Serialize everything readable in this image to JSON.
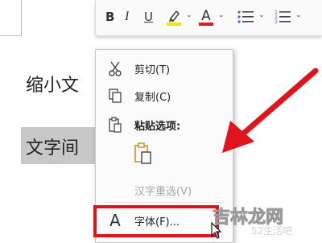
{
  "toolbar": {
    "bold": "B",
    "italic": "I",
    "underline": "U",
    "highlight_color": "#f2e600",
    "font_color": "#e01b1b",
    "font_color_glyph": "A"
  },
  "document": {
    "line1": "缩小文",
    "line2": "文字间"
  },
  "context_menu": {
    "items": [
      {
        "label": "剪切(T)",
        "icon": "scissors-icon"
      },
      {
        "label": "复制(C)",
        "icon": "copy-icon"
      },
      {
        "label": "粘贴选项:",
        "icon": "paste-icon"
      },
      {
        "label": "汉字重选(V)",
        "icon": "none"
      },
      {
        "label": "字体(F)...",
        "icon": "font-icon",
        "icon_glyph": "A"
      }
    ]
  },
  "annotation": {
    "color": "#e0141b"
  },
  "watermark": {
    "main": "吉林龙网",
    "sub": "52生活吧"
  }
}
